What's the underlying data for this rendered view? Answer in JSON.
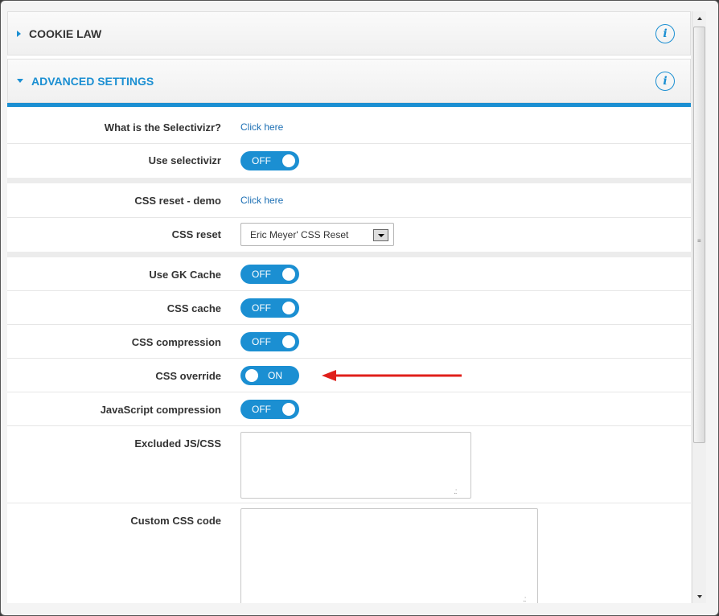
{
  "colors": {
    "accent": "#1b8fd2",
    "annotation_arrow": "#e0201b"
  },
  "sections": {
    "cookie_law": {
      "title": "COOKIE LAW",
      "expanded": false,
      "info_icon": "info-icon",
      "info_glyph": "i"
    },
    "advanced_settings": {
      "title": "ADVANCED SETTINGS",
      "expanded": true,
      "info_icon": "info-icon",
      "info_glyph": "i"
    }
  },
  "settings": {
    "selectivizr_info": {
      "label": "What is the Selectivizr?",
      "link_text": "Click here"
    },
    "use_selectivizr": {
      "label": "Use selectivizr",
      "state": "OFF"
    },
    "css_reset_demo": {
      "label": "CSS reset - demo",
      "link_text": "Click here"
    },
    "css_reset": {
      "label": "CSS reset",
      "selected": "Eric Meyer' CSS Reset"
    },
    "use_gk_cache": {
      "label": "Use GK Cache",
      "state": "OFF"
    },
    "css_cache": {
      "label": "CSS cache",
      "state": "OFF"
    },
    "css_compression": {
      "label": "CSS compression",
      "state": "OFF"
    },
    "css_override": {
      "label": "CSS override",
      "state": "ON"
    },
    "js_compression": {
      "label": "JavaScript compression",
      "state": "OFF"
    },
    "excluded_js_css": {
      "label": "Excluded JS/CSS",
      "value": ""
    },
    "custom_css_code": {
      "label": "Custom CSS code",
      "value": ""
    }
  }
}
